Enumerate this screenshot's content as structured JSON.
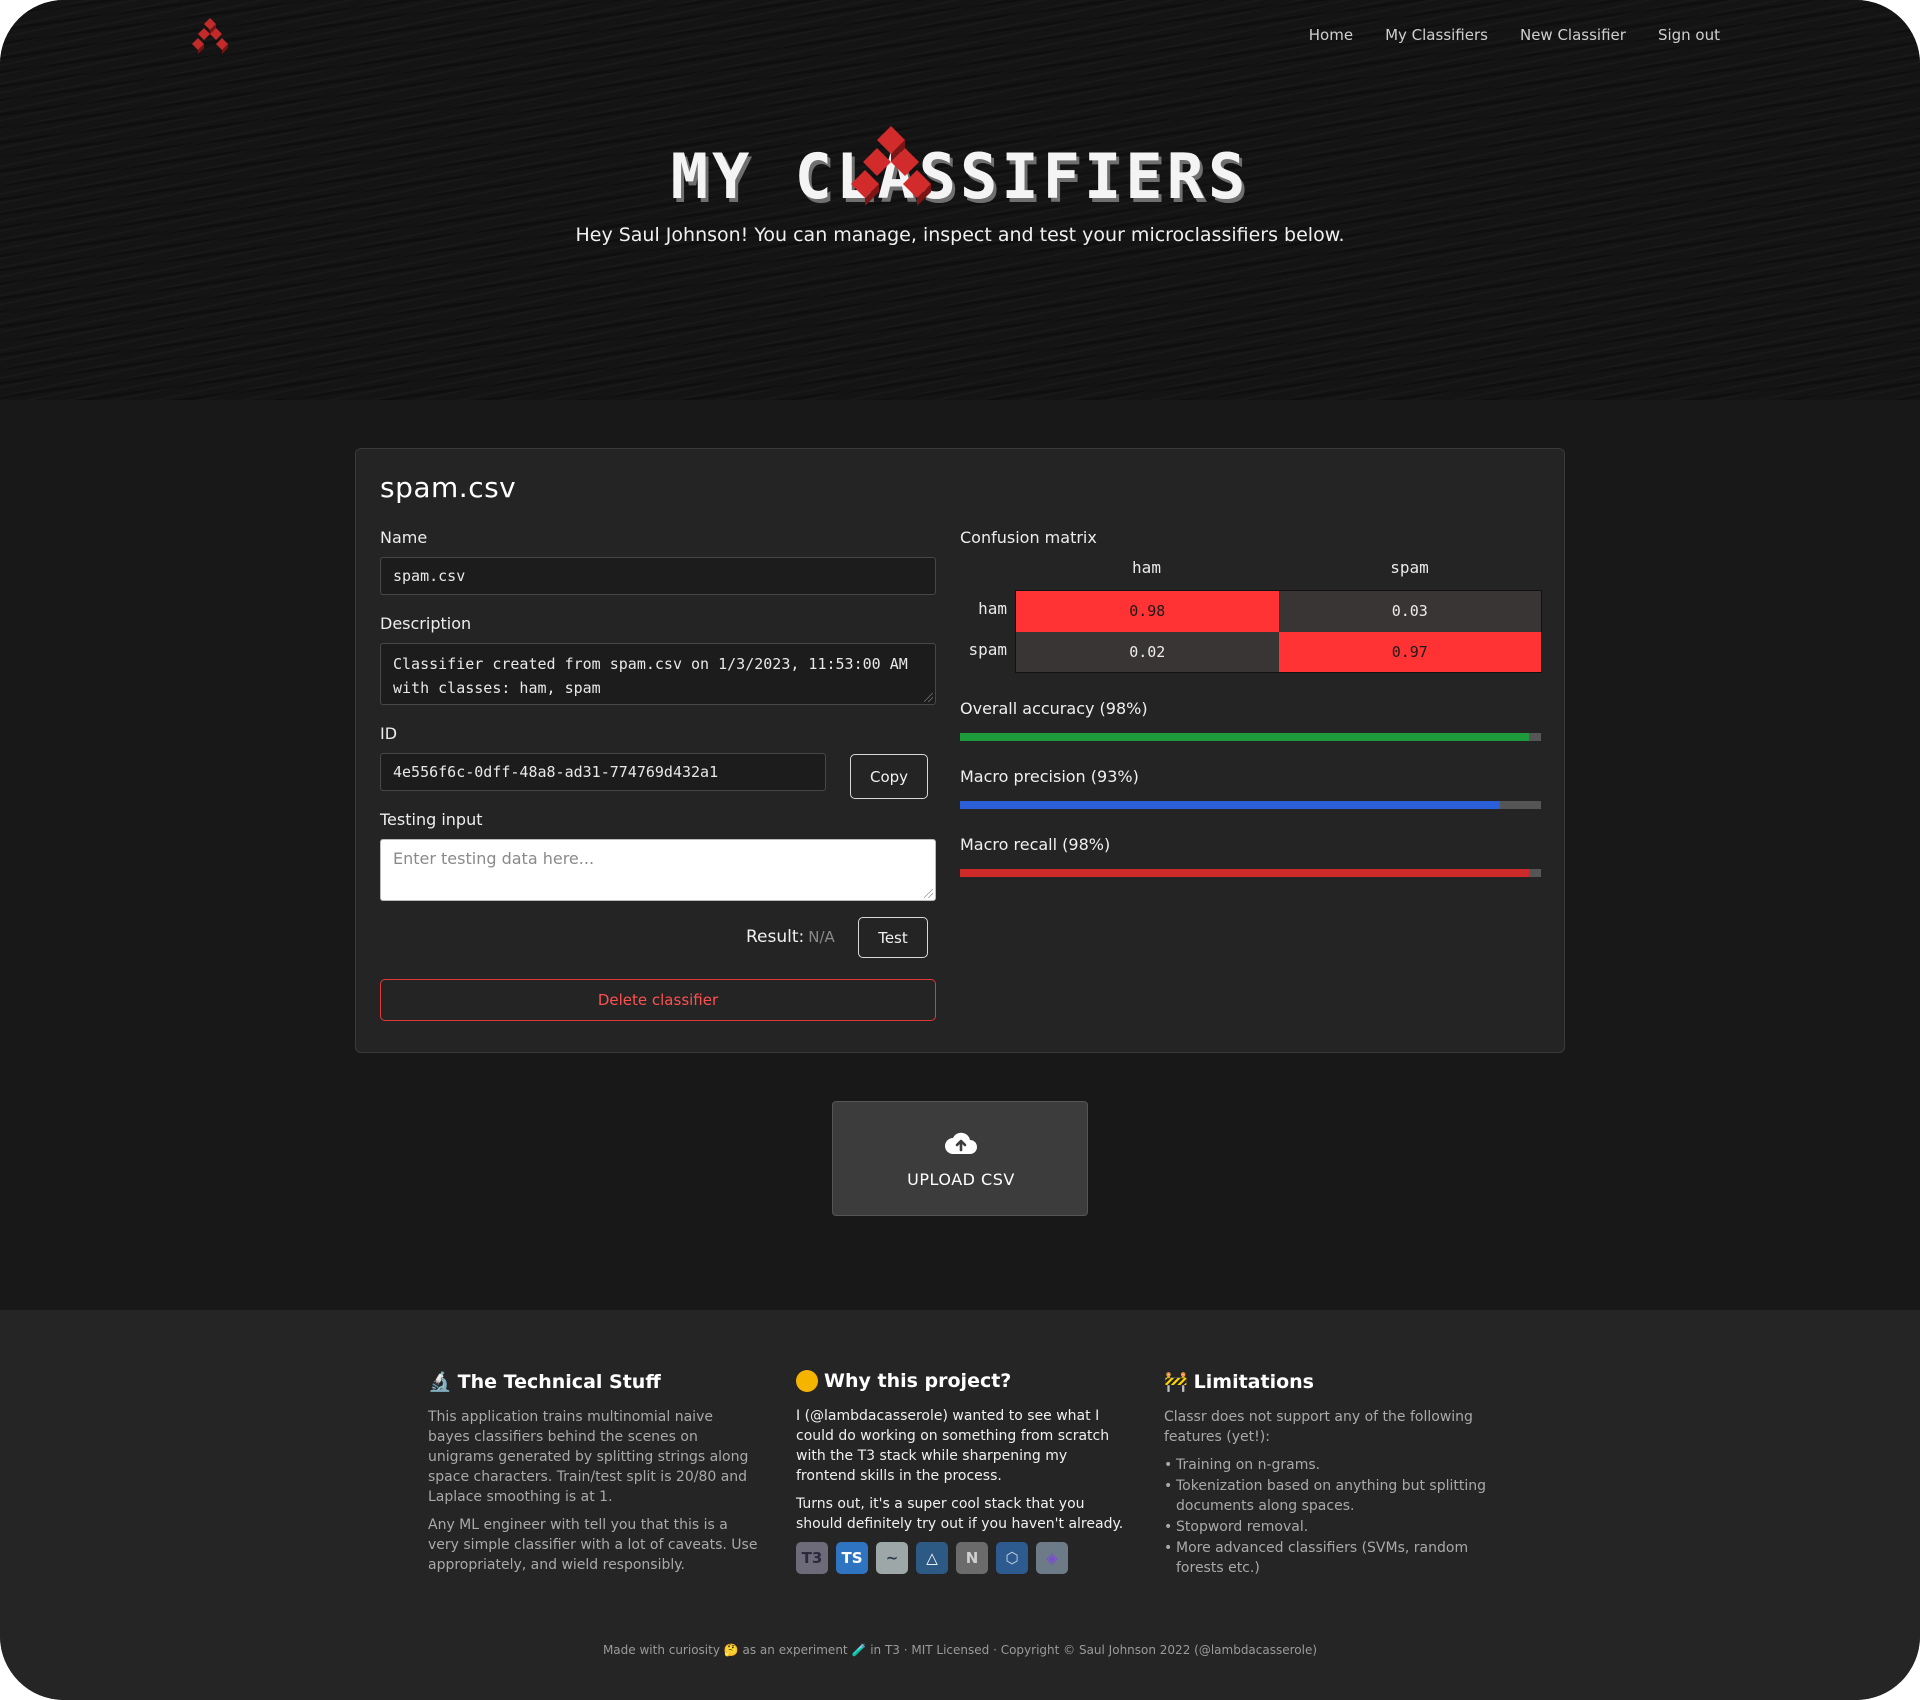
{
  "nav": {
    "links": [
      "Home",
      "My Classifiers",
      "New Classifier",
      "Sign out"
    ]
  },
  "hero": {
    "title": "MY CLASSIFIERS",
    "subtitle": "Hey Saul Johnson! You can manage, inspect and test your microclassifiers below."
  },
  "classifier": {
    "title": "spam.csv",
    "name_label": "Name",
    "name_value": "spam.csv",
    "description_label": "Description",
    "description_value": "Classifier created from spam.csv on 1/3/2023, 11:53:00 AM with classes: ham, spam",
    "id_label": "ID",
    "id_value": "4e556f6c-0dff-48a8-ad31-774769d432a1",
    "copy_label": "Copy",
    "testing_label": "Testing input",
    "testing_placeholder": "Enter testing data here...",
    "result_label": "Result:",
    "result_value": "N/A",
    "test_label": "Test",
    "delete_label": "Delete classifier"
  },
  "confusion": {
    "label": "Confusion matrix",
    "classes": [
      "ham",
      "spam"
    ],
    "values": [
      [
        "0.98",
        "0.03"
      ],
      [
        "0.02",
        "0.97"
      ]
    ]
  },
  "metrics": [
    {
      "label": "Overall accuracy (98%)",
      "value": 0.98,
      "color": "#1d9a3c"
    },
    {
      "label": "Macro precision (93%)",
      "value": 0.93,
      "color": "#2a5fd8"
    },
    {
      "label": "Macro recall (98%)",
      "value": 0.98,
      "color": "#cf2a2a"
    }
  ],
  "upload": {
    "label": "UPLOAD CSV",
    "icon": "cloud-upload-icon"
  },
  "footer": {
    "technical": {
      "title": "The Technical Stuff",
      "p1": "This application trains multinomial naive bayes classifiers behind the scenes on unigrams generated by splitting strings along space characters. Train/test split is 20/80 and Laplace smoothing is at 1.",
      "p2": "Any ML engineer with tell you that this is a very simple classifier with a lot of caveats. Use appropriately, and wield responsibly."
    },
    "why": {
      "title": "Why this project?",
      "p1": "I (@lambdacasserole) wanted to see what I could do working on something from scratch with the T3 stack while sharpening my frontend skills in the process.",
      "p2": "Turns out, it's a super cool stack that you should definitely try out if you haven't already.",
      "stack": [
        "T3",
        "TS",
        "~",
        "△",
        "N",
        "⬡",
        "◈"
      ]
    },
    "limitations": {
      "title": "Limitations",
      "intro": "Classr does not support any of the following features (yet!):",
      "items": [
        "Training on n-grams.",
        "Tokenization based on anything but splitting documents along spaces.",
        "Stopword removal.",
        "More advanced classifiers (SVMs, random forests etc.)"
      ]
    },
    "copyright": "Made with curiosity 🤔 as an experiment 🧪 in T3 · MIT Licensed · Copyright © Saul Johnson 2022 (@lambdacasserole)"
  },
  "colors": {
    "accent": "#ff3333",
    "background": "#181818",
    "card": "#242424"
  }
}
